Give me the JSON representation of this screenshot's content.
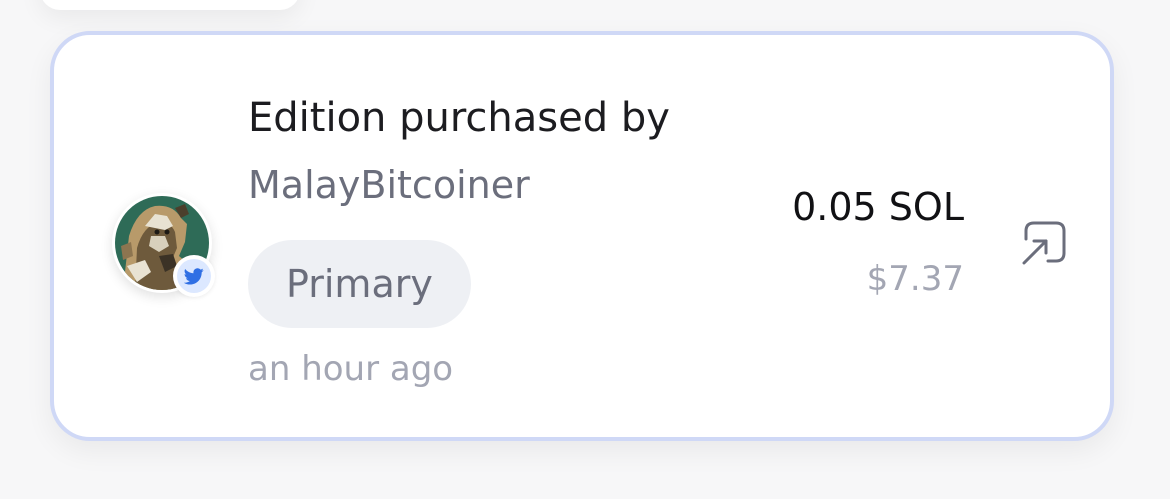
{
  "event": {
    "title": "Edition purchased by",
    "buyer": "MalayBitcoiner",
    "sale_type": "Primary",
    "time_ago": "an hour ago",
    "price": "0.05 SOL",
    "price_usd": "$7.37"
  },
  "icons": {
    "avatar": "nft-avatar-image",
    "social_badge": "twitter-icon",
    "external": "external-link-arrow-icon"
  },
  "colors": {
    "card_border": "#cfd8f6",
    "twitter_blue": "#2f6fe4",
    "badge_bg": "#dce8ff",
    "tag_bg": "#eef0f4",
    "muted_text": "#a3a6b3",
    "secondary_text": "#6b6e7c",
    "primary_text": "#1c1c20"
  }
}
